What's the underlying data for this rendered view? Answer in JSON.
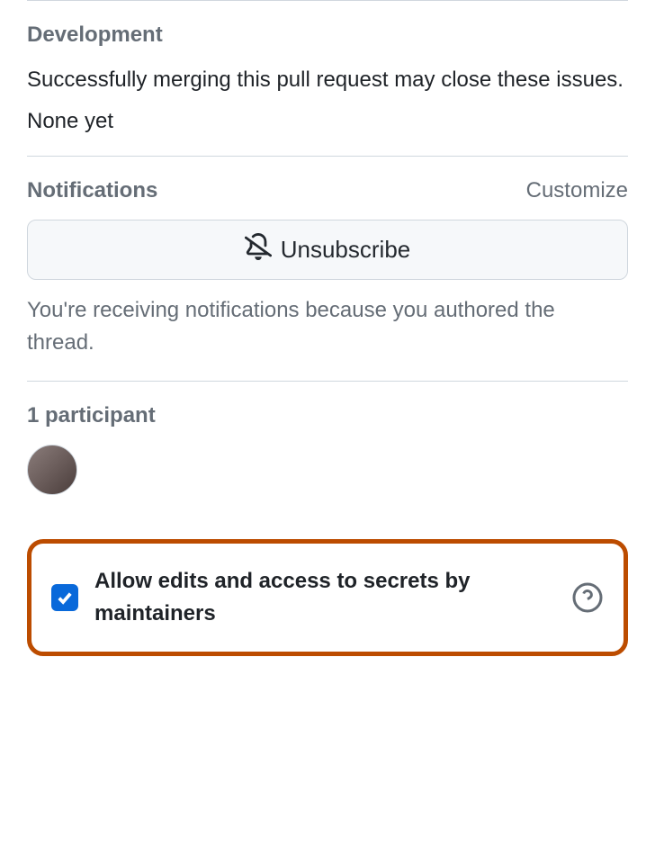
{
  "development": {
    "heading": "Development",
    "description": "Successfully merging this pull request may close these issues.",
    "empty": "None yet"
  },
  "notifications": {
    "heading": "Notifications",
    "customize": "Customize",
    "unsubscribe": "Unsubscribe",
    "reason": "You're receiving notifications because you authored the thread."
  },
  "participants": {
    "heading": "1 participant"
  },
  "allowEdits": {
    "label": "Allow edits and access to secrets by maintainers",
    "checked": true
  }
}
